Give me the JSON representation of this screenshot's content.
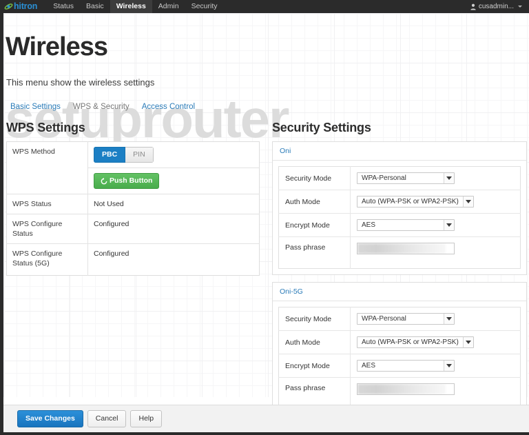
{
  "topbar": {
    "brand": "hitron",
    "nav": [
      {
        "label": "Status",
        "active": false
      },
      {
        "label": "Basic",
        "active": false
      },
      {
        "label": "Wireless",
        "active": true
      },
      {
        "label": "Admin",
        "active": false
      },
      {
        "label": "Security",
        "active": false
      }
    ],
    "user": "cusadmin...",
    "icons": {
      "user": "user-icon",
      "caret": "chevron-down-icon"
    }
  },
  "page": {
    "title": "Wireless",
    "subtitle": "This menu show the wireless settings",
    "watermark": "setuprouter"
  },
  "tabs": [
    {
      "label": "Basic Settings",
      "current": false
    },
    {
      "label": "WPS & Security",
      "current": true
    },
    {
      "label": "Access Control",
      "current": false
    }
  ],
  "wps": {
    "heading": "WPS Settings",
    "method_label": "WPS Method",
    "method_options": [
      {
        "label": "PBC",
        "selected": true
      },
      {
        "label": "PIN",
        "selected": false
      }
    ],
    "push_button_label": "Push Button",
    "push_button_icon": "refresh-icon",
    "rows": [
      {
        "key": "WPS Status",
        "value": "Not Used"
      },
      {
        "key": "WPS Configure Status",
        "value": "Configured"
      },
      {
        "key": "WPS Configure Status (5G)",
        "value": "Configured"
      }
    ]
  },
  "security": {
    "heading": "Security Settings",
    "labels": {
      "security_mode": "Security Mode",
      "auth_mode": "Auth Mode",
      "encrypt_mode": "Encrypt Mode",
      "pass_phrase": "Pass phrase"
    },
    "networks": [
      {
        "ssid": "Oni",
        "security_mode": "WPA-Personal",
        "auth_mode": "Auto (WPA-PSK or WPA2-PSK)",
        "encrypt_mode": "AES",
        "pass_phrase": ""
      },
      {
        "ssid": "Oni-5G",
        "security_mode": "WPA-Personal",
        "auth_mode": "Auto (WPA-PSK or WPA2-PSK)",
        "encrypt_mode": "AES",
        "pass_phrase": ""
      }
    ]
  },
  "footer": {
    "save_label": "Save Changes",
    "cancel_label": "Cancel",
    "help_label": "Help"
  },
  "colors": {
    "brand_blue": "#2a8fd4",
    "link_blue": "#2a7bb8",
    "accent_blue": "#1c7fc4",
    "green": "#49ad4c",
    "dark": "#2b2b2b"
  }
}
